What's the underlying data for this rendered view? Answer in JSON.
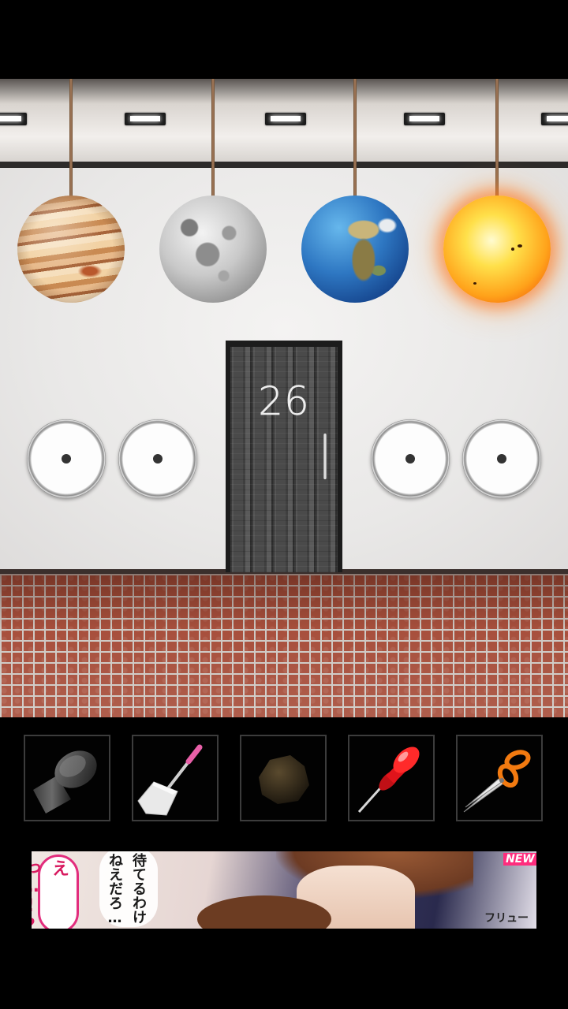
{
  "room": {
    "door_number": "26",
    "planets": [
      "jupiter",
      "moon",
      "earth",
      "sun"
    ],
    "dials": 4
  },
  "inventory": {
    "items": [
      "bolt-icon",
      "dustpan-icon",
      "rock-icon",
      "pushpin-icon",
      "scissors-icon"
    ]
  },
  "ad": {
    "left_bubble": "えっ…!?",
    "mid_bubble": "待てるわけねえだろ…",
    "badge": "NEW",
    "brand": "フリュー"
  },
  "colors": {
    "pin_red": "#e0141b",
    "scissors_orange": "#f27a10",
    "ad_pink": "#e22d7d"
  }
}
